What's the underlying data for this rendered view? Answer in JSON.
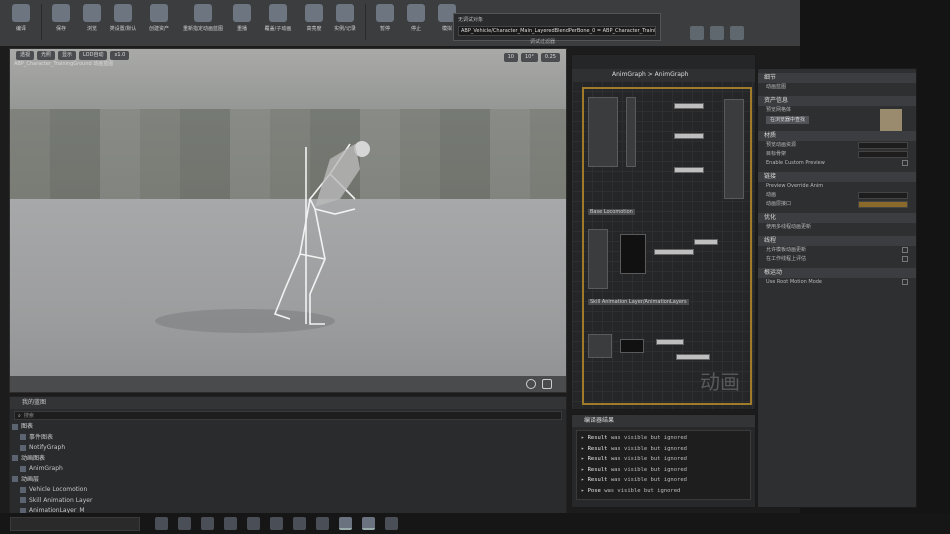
{
  "toolbar": {
    "buttons": [
      {
        "label": "编译",
        "icon": "compile-gear-icon"
      },
      {
        "label": "保存",
        "icon": "save-icon"
      },
      {
        "label": "浏览",
        "icon": "browse-search-icon"
      },
      {
        "label": "类设置/默认",
        "icon": "class-settings-icon"
      },
      {
        "label": "创建资产",
        "icon": "create-asset-icon"
      },
      {
        "label": "重新指定动画蓝图",
        "icon": "retarget-icon"
      },
      {
        "label": "重播",
        "icon": "replay-icon"
      },
      {
        "label": "覆盖/子动画",
        "icon": "override-icon"
      },
      {
        "label": "高亮度",
        "icon": "highlight-icon"
      },
      {
        "label": "实例/记录",
        "icon": "record-icon"
      },
      {
        "label": "暂停",
        "icon": "pause-icon"
      },
      {
        "label": "停止",
        "icon": "stop-icon"
      },
      {
        "label": "模拟",
        "icon": "simulate-icon"
      }
    ],
    "debug_title": "无调试对象",
    "debug_value": "ABP_Vehicle/Character_Main_LayeredBlendPerBone_0 = ABP_Character_TrainingGround",
    "debug_caption": "调试过滤器"
  },
  "viewport": {
    "title": "ABP_Character_TrainingGround 动画蓝图",
    "controls": [
      "透视",
      "光照",
      "显示",
      "LOD自动",
      "x1.0"
    ],
    "right_controls": [
      "10",
      "10°",
      "0.25"
    ]
  },
  "anim_panel": {
    "tab": "我的蓝图",
    "search_placeholder": "搜索",
    "items": [
      {
        "text": "图表",
        "header": true
      },
      {
        "text": "事件图表",
        "header": false
      },
      {
        "text": "NotifyGraph",
        "header": false
      },
      {
        "text": "动画图表",
        "header": true
      },
      {
        "text": "AnimGraph",
        "header": false
      },
      {
        "text": "动画层",
        "header": true
      },
      {
        "text": "Vehicle Locomotion",
        "header": false
      },
      {
        "text": "Skill Animation Layer",
        "header": false
      },
      {
        "text": "AnimationLayer_M",
        "header": false
      }
    ]
  },
  "graph": {
    "breadcrumb": "AnimGraph > AnimGraph",
    "groups": [
      "Base Locomotion",
      "Skill Animation Layer/AnimationLayers"
    ],
    "watermark": "动画"
  },
  "log": {
    "tab": "编译器结果",
    "lines": [
      {
        "key": "Result",
        "text": "was visible but ignored"
      },
      {
        "key": "Result",
        "text": "was visible but ignored"
      },
      {
        "key": "Result",
        "text": "was visible but ignored"
      },
      {
        "key": "Result",
        "text": "was visible but ignored"
      },
      {
        "key": "Result",
        "text": "was visible but ignored"
      },
      {
        "key": "Pose",
        "text": "was visible but ignored"
      }
    ]
  },
  "details": {
    "sections": [
      {
        "title": "细节",
        "rows": [
          "动画蓝图"
        ]
      },
      {
        "title": "资产信息",
        "rows": [
          "预览网格体",
          "在浏览器中查找"
        ]
      },
      {
        "title": "材质",
        "rows": [
          "预览动画资源",
          "目标骨架",
          "Enable Custom Preview"
        ]
      },
      {
        "title": "链接",
        "rows": [
          "Preview Override Anim",
          "动画",
          "动画层接口"
        ]
      },
      {
        "title": "优化",
        "rows": [
          "使用多线程动画更新"
        ]
      },
      {
        "title": "线程",
        "rows": [
          "允许模板动画更新",
          "在工作线程上评估"
        ]
      },
      {
        "title": "根运动",
        "rows": [
          "Use Root Motion Mode"
        ]
      }
    ]
  },
  "colors": {
    "toolbar_bg": "#3c3d3f",
    "graph_frame": "#a07b2a",
    "panel_bg": "#2e2f31"
  }
}
